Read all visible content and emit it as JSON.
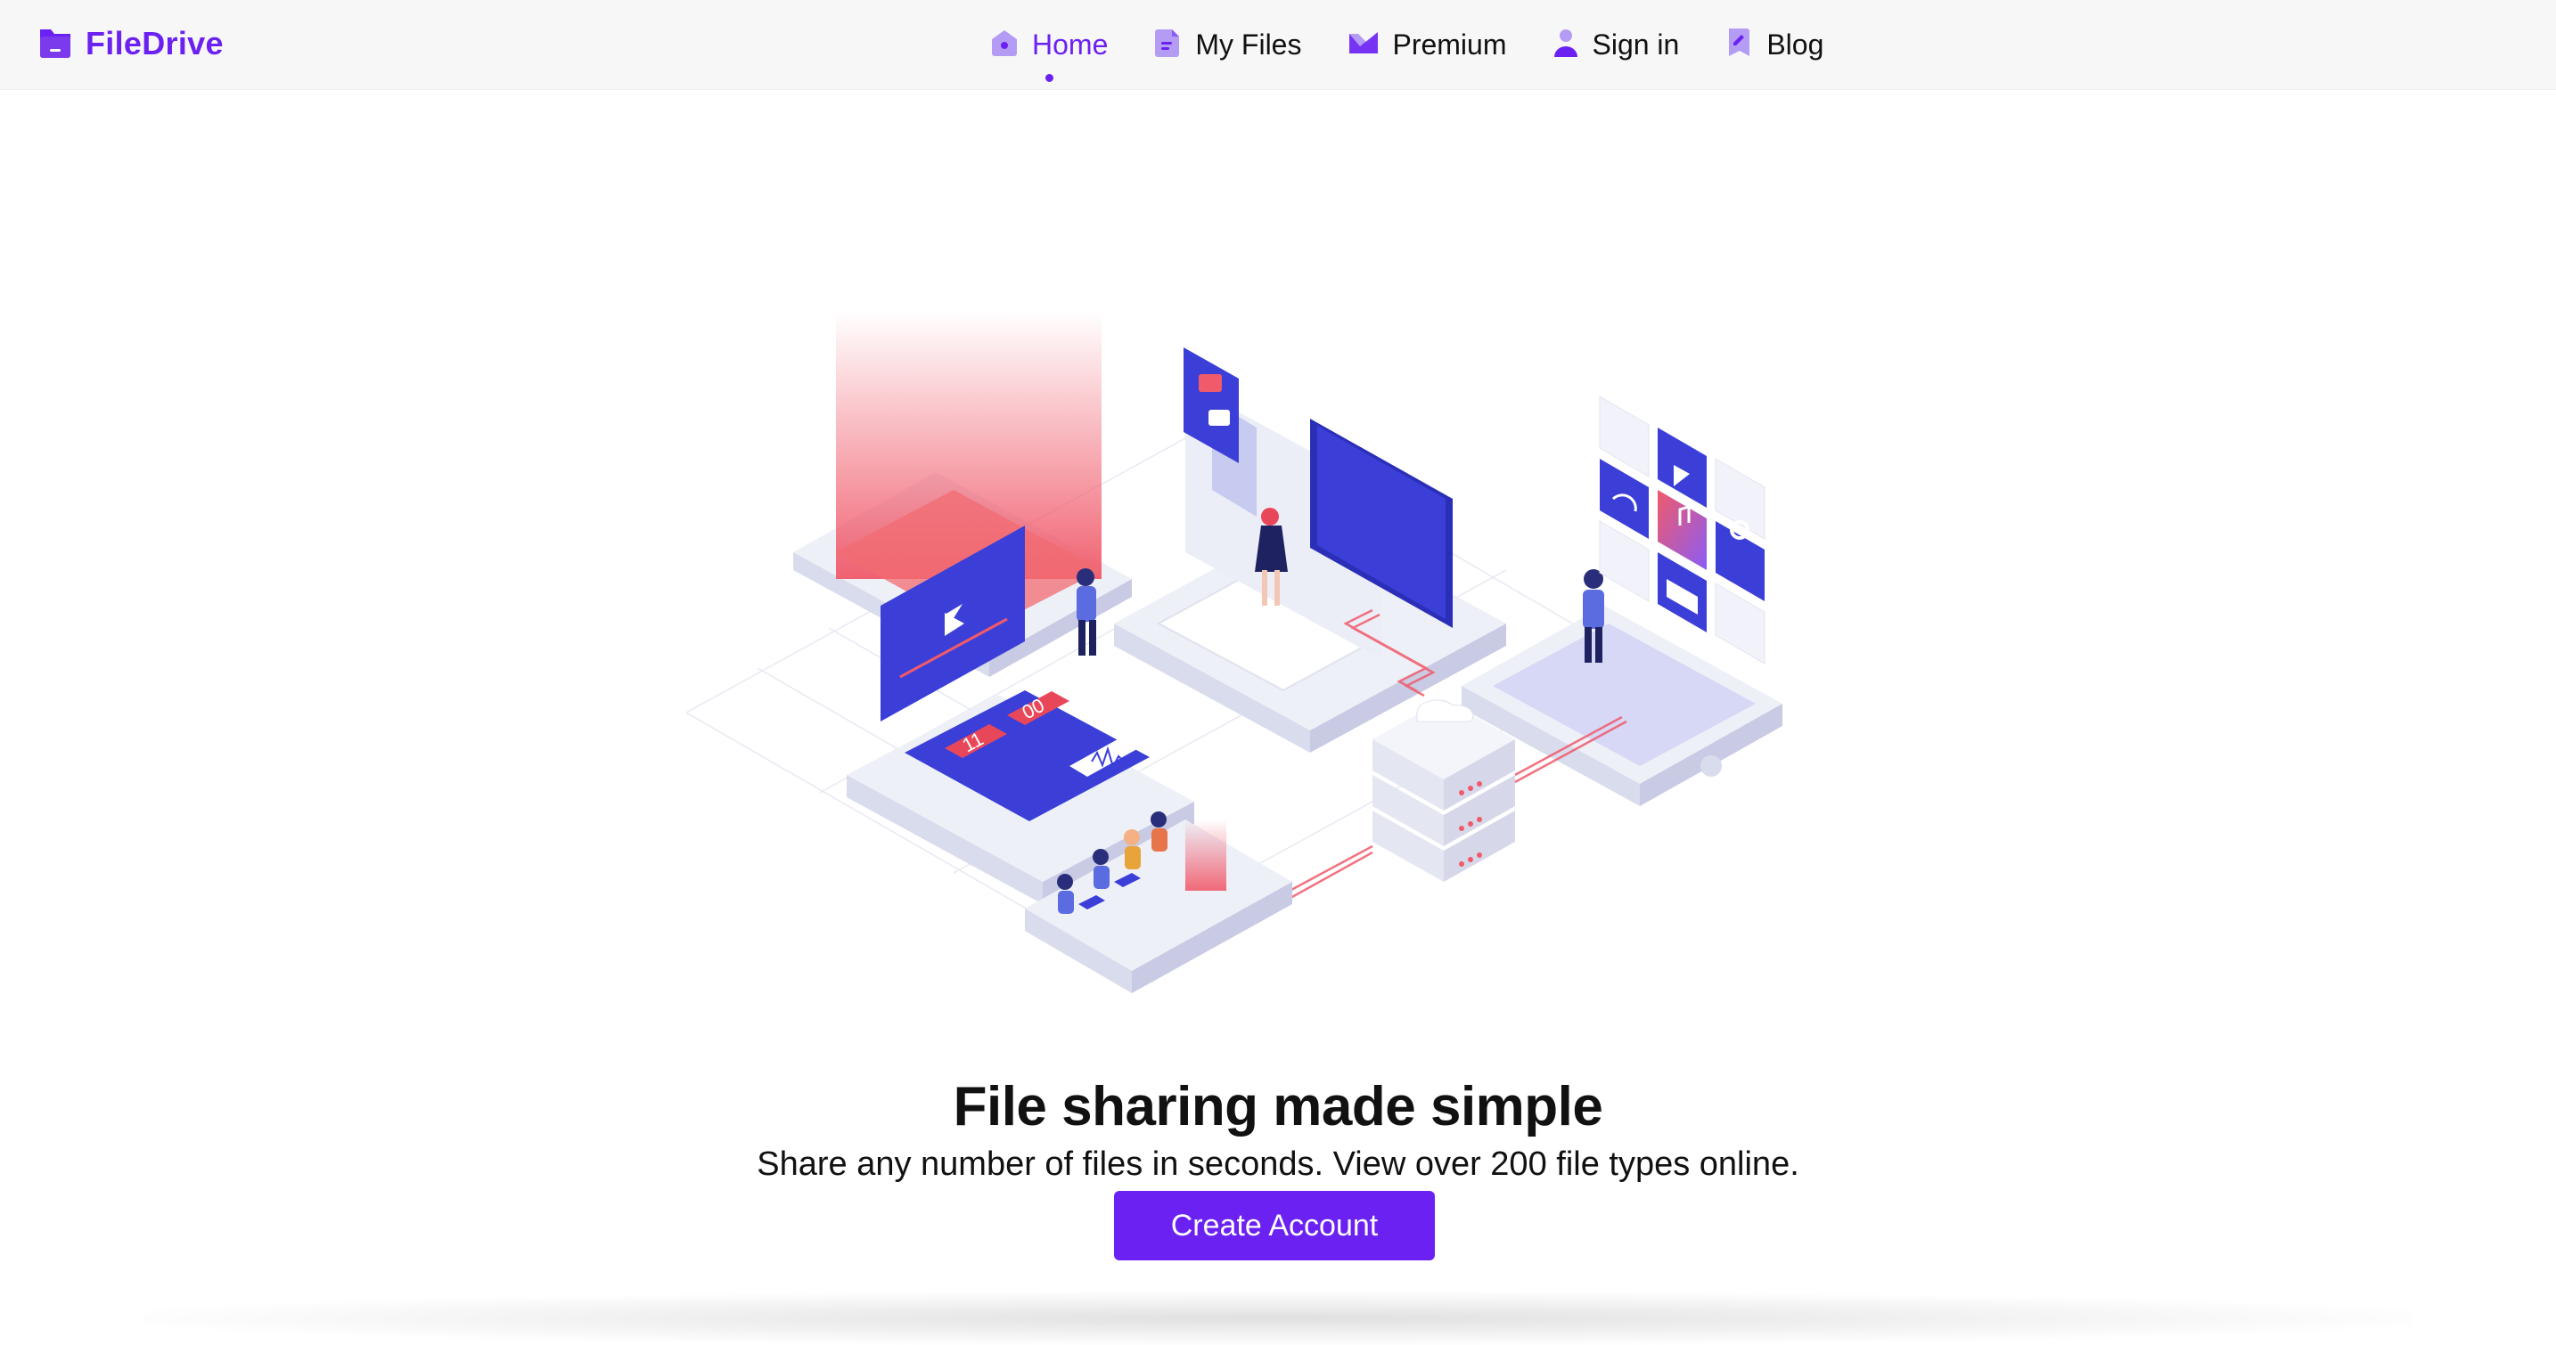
{
  "brand": {
    "name": "FileDrive",
    "icon": "folder-icon"
  },
  "nav": {
    "items": [
      {
        "label": "Home",
        "icon": "home-icon",
        "active": true
      },
      {
        "label": "My Files",
        "icon": "file-icon",
        "active": false
      },
      {
        "label": "Premium",
        "icon": "crown-icon",
        "active": false
      },
      {
        "label": "Sign in",
        "icon": "user-icon",
        "active": false
      },
      {
        "label": "Blog",
        "icon": "bookmark-icon",
        "active": false
      }
    ]
  },
  "hero": {
    "illustration": "isometric-file-sharing-illustration",
    "headline": "File sharing made simple",
    "subheadline": "Share any number of files in seconds. View over 200 file types online.",
    "cta_label": "Create Account",
    "timer_hours": "11",
    "timer_minutes": "00"
  },
  "colors": {
    "accent": "#6b21f2",
    "nav_bg": "#f7f7f7",
    "illustration_blue": "#3b3fd8",
    "illustration_red": "#f05a6a"
  }
}
